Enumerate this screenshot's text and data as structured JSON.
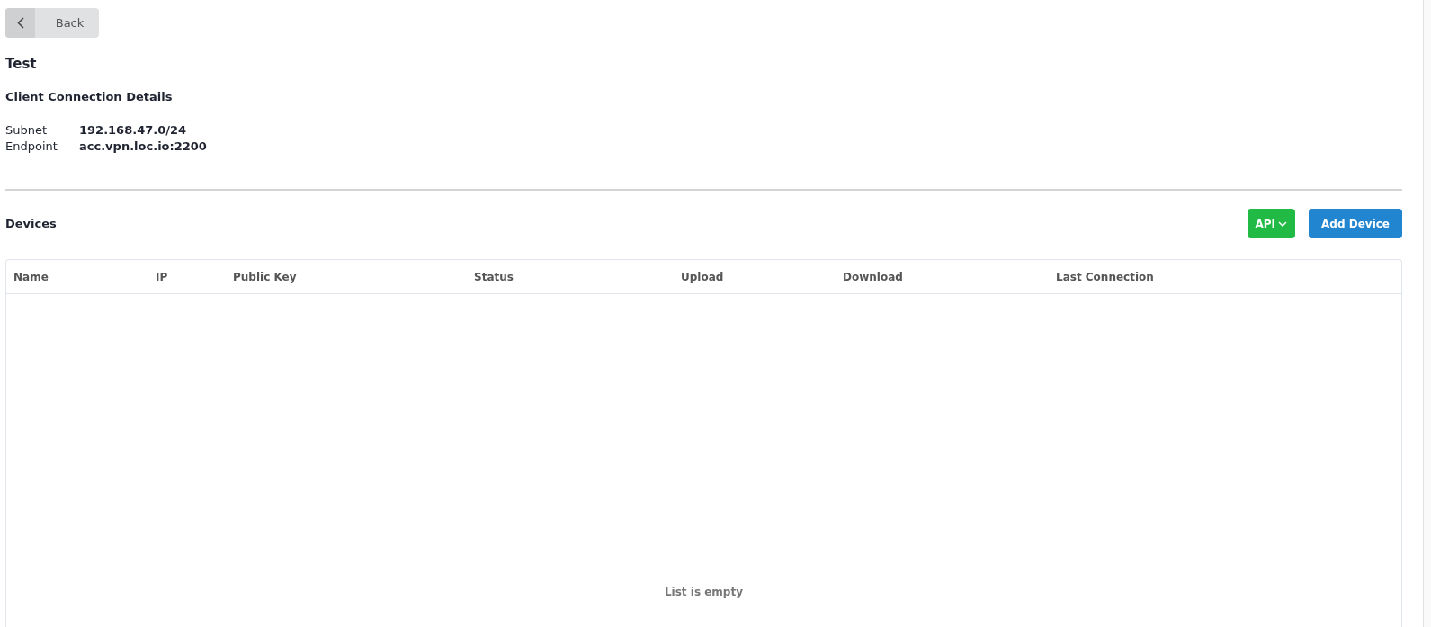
{
  "back_button": {
    "label": "Back"
  },
  "title": "Test",
  "connection_details": {
    "heading": "Client Connection Details",
    "fields": [
      {
        "label": "Subnet",
        "value": "192.168.47.0/24"
      },
      {
        "label": "Endpoint",
        "value": "acc.vpn.loc.io:2200"
      }
    ]
  },
  "devices": {
    "heading": "Devices",
    "buttons": [
      {
        "kind": "dropdown",
        "label": "API"
      },
      {
        "kind": "primary",
        "label": "Add Device"
      }
    ],
    "table": {
      "columns": [
        "Name",
        "IP",
        "Public Key",
        "Status",
        "Upload",
        "Download",
        "Last Connection"
      ],
      "empty_message": "List is empty"
    }
  }
}
